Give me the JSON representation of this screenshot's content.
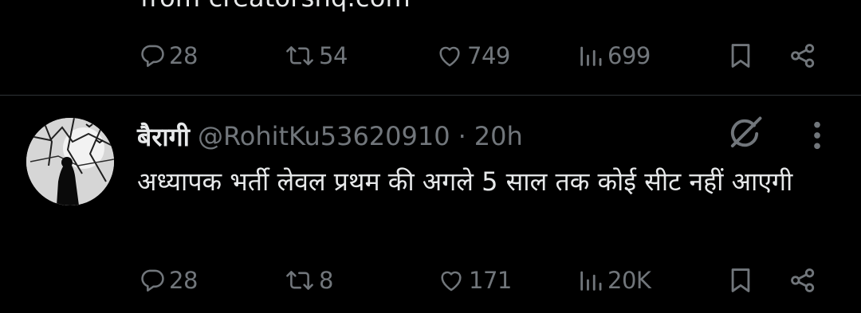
{
  "previous_tweet": {
    "partial_text": "from creatorshq.com",
    "actions": {
      "replies": "28",
      "reposts": "54",
      "likes": "749",
      "views": "699"
    }
  },
  "tweet": {
    "display_name": "बैरागी",
    "handle": "@RohitKu53620910",
    "separator": "·",
    "time": "20h",
    "text": "अध्यापक भर्ती लेवल प्रथम की अगले 5 साल तक कोई सीट नहीं आएगी",
    "actions": {
      "replies": "28",
      "reposts": "8",
      "likes": "171",
      "views": "20K"
    }
  },
  "icons": {
    "reply": "reply-icon",
    "repost": "repost-icon",
    "like": "heart-icon",
    "views": "views-icon",
    "bookmark": "bookmark-icon",
    "share": "share-icon",
    "grok": "grok-icon",
    "more": "more-icon"
  },
  "colors": {
    "background": "#000000",
    "text": "#e7e9ea",
    "muted": "#71767b",
    "divider": "#2f3336"
  }
}
